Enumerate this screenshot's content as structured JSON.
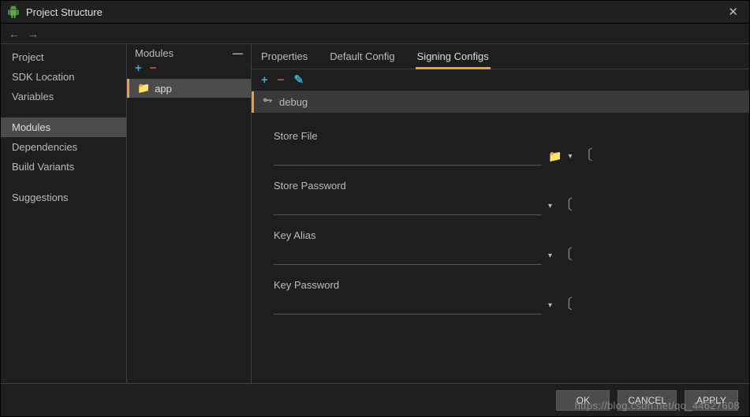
{
  "window": {
    "title": "Project Structure"
  },
  "sidebar": {
    "items": [
      {
        "id": "project",
        "label": "Project"
      },
      {
        "id": "sdk-location",
        "label": "SDK Location"
      },
      {
        "id": "variables",
        "label": "Variables"
      },
      {
        "id": "modules",
        "label": "Modules",
        "selected": true
      },
      {
        "id": "dependencies",
        "label": "Dependencies"
      },
      {
        "id": "build-variants",
        "label": "Build Variants"
      },
      {
        "id": "suggestions",
        "label": "Suggestions"
      }
    ]
  },
  "modules": {
    "header": "Modules",
    "items": [
      {
        "name": "app",
        "selected": true
      }
    ]
  },
  "tabs": [
    {
      "id": "properties",
      "label": "Properties"
    },
    {
      "id": "default-config",
      "label": "Default Config"
    },
    {
      "id": "signing-configs",
      "label": "Signing Configs",
      "active": true
    }
  ],
  "config": {
    "selected": "debug"
  },
  "form": {
    "storeFile": {
      "label": "Store File",
      "value": ""
    },
    "storePassword": {
      "label": "Store Password",
      "value": ""
    },
    "keyAlias": {
      "label": "Key Alias",
      "value": ""
    },
    "keyPassword": {
      "label": "Key Password",
      "value": ""
    }
  },
  "footer": {
    "ok": "OK",
    "cancel": "CANCEL",
    "apply": "APPLY"
  },
  "watermark": "https://blog.csdn.net/qq_44627608",
  "icons": {
    "plus": "+",
    "minus": "−",
    "pencil": "✎",
    "folder": "📁",
    "key": "⚿",
    "chevronDown": "▾",
    "minimize": "—",
    "close": "✕",
    "arrowLeft": "←",
    "arrowRight": "→"
  }
}
